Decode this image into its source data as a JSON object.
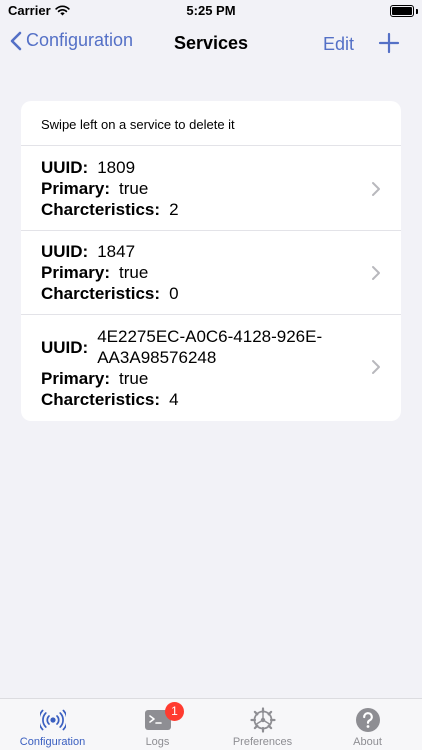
{
  "status_bar": {
    "carrier": "Carrier",
    "time": "5:25 PM"
  },
  "nav": {
    "back_label": "Configuration",
    "title": "Services",
    "edit_label": "Edit",
    "add_icon": "plus-icon"
  },
  "card": {
    "hint": "Swipe left on a service to delete it"
  },
  "labels": {
    "uuid": "UUID:",
    "primary": "Primary:",
    "characteristics": "Charcteristics:"
  },
  "services": [
    {
      "uuid": "1809",
      "primary": "true",
      "characteristics": "2"
    },
    {
      "uuid": "1847",
      "primary": "true",
      "characteristics": "0"
    },
    {
      "uuid": "4E2275EC-A0C6-4128-926E-AA3A98576248",
      "primary": "true",
      "characteristics": "4"
    }
  ],
  "tabs": [
    {
      "label": "Configuration",
      "icon": "broadcast-icon",
      "active": true
    },
    {
      "label": "Logs",
      "icon": "terminal-icon",
      "badge": "1"
    },
    {
      "label": "Preferences",
      "icon": "gear-icon"
    },
    {
      "label": "About",
      "icon": "question-icon"
    }
  ],
  "colors": {
    "accent": "#5470c6",
    "background": "#f2f2f7",
    "badge": "#ff3b30",
    "inactive_tab": "#8e8e93"
  }
}
